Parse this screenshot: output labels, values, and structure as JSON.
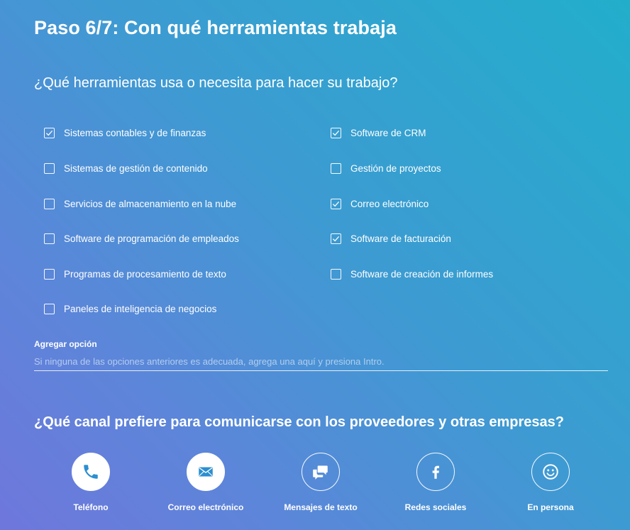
{
  "step_title": "Paso 6/7: Con qué herramientas trabaja",
  "question_tools": "¿Qué herramientas usa o necesita para hacer su trabajo?",
  "options_left": [
    {
      "label": "Sistemas contables y de finanzas",
      "checked": true
    },
    {
      "label": "Sistemas de gestión de contenido",
      "checked": false
    },
    {
      "label": "Servicios de almacenamiento en la nube",
      "checked": false
    },
    {
      "label": "Software de programación de empleados",
      "checked": false
    },
    {
      "label": "Programas de procesamiento de texto",
      "checked": false
    },
    {
      "label": "Paneles de inteligencia de negocios",
      "checked": false
    }
  ],
  "options_right": [
    {
      "label": "Software de CRM",
      "checked": true
    },
    {
      "label": "Gestión de proyectos",
      "checked": false
    },
    {
      "label": "Correo electrónico",
      "checked": true
    },
    {
      "label": "Software de facturación",
      "checked": true
    },
    {
      "label": "Software de creación de informes",
      "checked": false
    }
  ],
  "add_option": {
    "label": "Agregar opción",
    "value": "",
    "placeholder": "Si ninguna de las opciones anteriores es adecuada, agrega una aquí y presiona Intro."
  },
  "question_channel": "¿Qué canal prefiere para comunicarse con los proveedores y otras empresas?",
  "channels": [
    {
      "label": "Teléfono",
      "icon": "phone-icon",
      "selected": true
    },
    {
      "label": "Correo electrónico",
      "icon": "envelope-icon",
      "selected": true
    },
    {
      "label": "Mensajes de texto",
      "icon": "chat-bubbles-icon",
      "selected": false
    },
    {
      "label": "Redes sociales",
      "icon": "facebook-icon",
      "selected": false
    },
    {
      "label": "En persona",
      "icon": "smiley-icon",
      "selected": false
    }
  ],
  "colors": {
    "icon_blue": "#2b8fd0",
    "gradient_start": "#22aecb",
    "gradient_end": "#6f77dc"
  }
}
